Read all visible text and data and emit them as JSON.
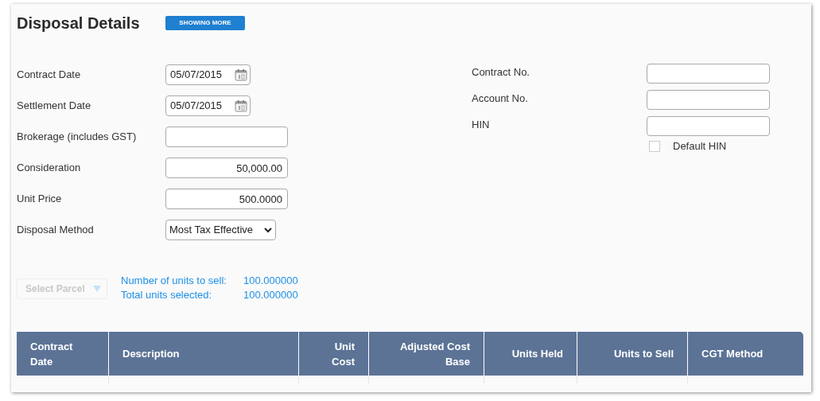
{
  "title": "Disposal Details",
  "toggle_button": {
    "label": "SHOWING MORE"
  },
  "left_fields": [
    {
      "label": "Contract Date",
      "kind": "date",
      "value": "05/07/2015"
    },
    {
      "label": "Settlement Date",
      "kind": "date",
      "value": "05/07/2015"
    },
    {
      "label": "Brokerage (includes GST)",
      "kind": "text"
    },
    {
      "label": "Consideration",
      "kind": "number",
      "value": "50,000.00"
    },
    {
      "label": "Unit Price",
      "kind": "number",
      "value": "500.0000"
    },
    {
      "label": "Disposal Method",
      "kind": "select",
      "value": "Most Tax Effective"
    }
  ],
  "right_fields": [
    {
      "label": "Contract No."
    },
    {
      "label": "Account No."
    },
    {
      "label": "HIN"
    }
  ],
  "default_hin": {
    "label": "Default HIN",
    "checked": false
  },
  "select_parcel": {
    "label": "Select Parcel",
    "disabled": true
  },
  "summary": [
    {
      "label": "Number of units to sell:",
      "value": "100.000000"
    },
    {
      "label": "Total units selected:",
      "value": "100.000000"
    }
  ],
  "table": {
    "columns": [
      {
        "label": "Contract Date",
        "kind": "text"
      },
      {
        "label": "Description",
        "kind": "text"
      },
      {
        "label": "Unit Cost",
        "kind": "number"
      },
      {
        "label": "Adjusted Cost Base",
        "kind": "number"
      },
      {
        "label": "Units Held",
        "kind": "number"
      },
      {
        "label": "Units to Sell",
        "kind": "number"
      },
      {
        "label": "CGT Method",
        "kind": "text"
      }
    ]
  }
}
